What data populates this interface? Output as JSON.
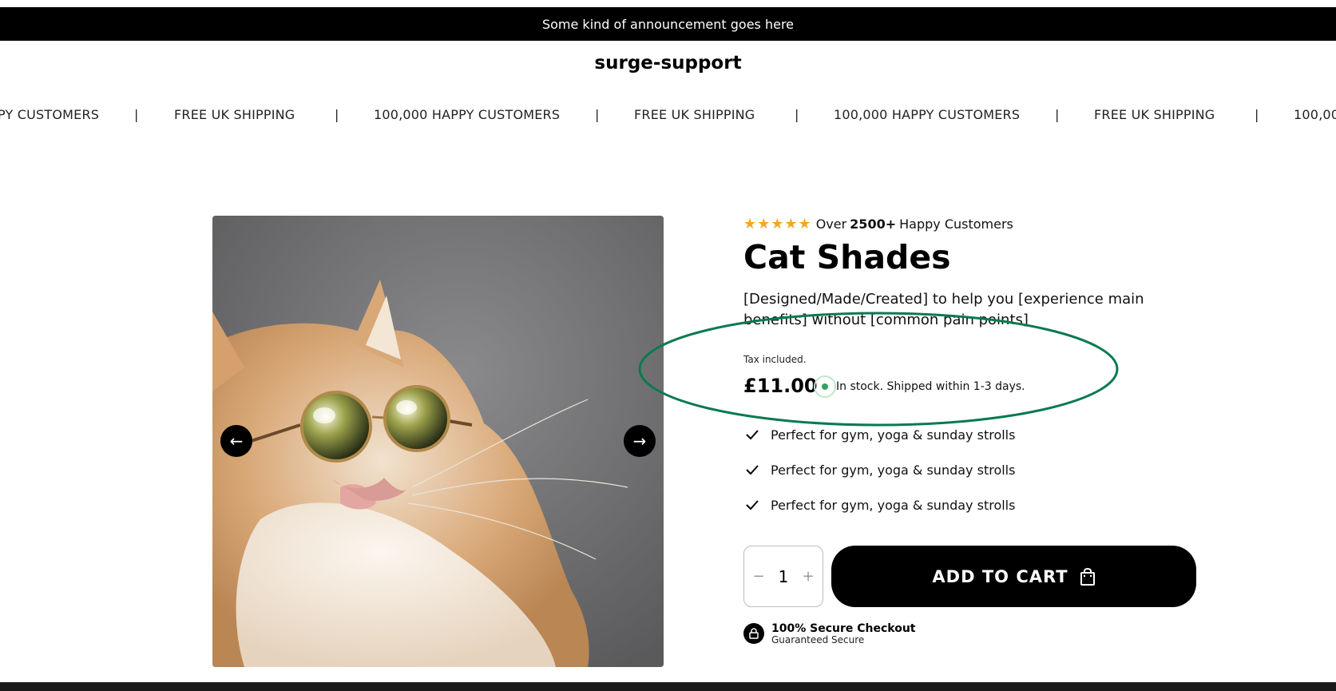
{
  "announcement": "Some kind of announcement goes here",
  "brand": "surge-support",
  "marquee": {
    "items": [
      "PY CUSTOMERS",
      "FREE UK SHIPPING",
      "100,000 HAPPY CUSTOMERS",
      "FREE UK SHIPPING",
      "100,000 HAPPY CUSTOMERS",
      "FREE UK SHIPPING",
      "100,00"
    ],
    "separator": "|"
  },
  "gallery": {
    "prev_icon": "←",
    "next_icon": "→",
    "image_icon": "cat-with-sunglasses"
  },
  "product": {
    "rating_stars": "★★★★★",
    "rating_prefix": "Over",
    "rating_count": "2500+",
    "rating_suffix": "Happy Customers",
    "title": "Cat Shades",
    "description": "[Designed/Made/Created] to help you [experience main benefits] without [common pain points]",
    "tax_note": "Tax included.",
    "price": "£11.00",
    "stock_text": "In stock. Shipped within 1-3 days.",
    "features": [
      "Perfect for gym, yoga & sunday strolls",
      "Perfect for gym, yoga & sunday strolls",
      "Perfect for gym, yoga & sunday strolls"
    ],
    "quantity": "1",
    "qty_minus": "−",
    "qty_plus": "+",
    "add_to_cart": "ADD TO CART",
    "secure_title": "100% Secure Checkout",
    "secure_subtitle": "Guaranteed Secure"
  },
  "colors": {
    "star": "#f5a623",
    "stock_dot": "#2ea55b",
    "highlight": "#0a7a4f",
    "button": "#000000"
  }
}
